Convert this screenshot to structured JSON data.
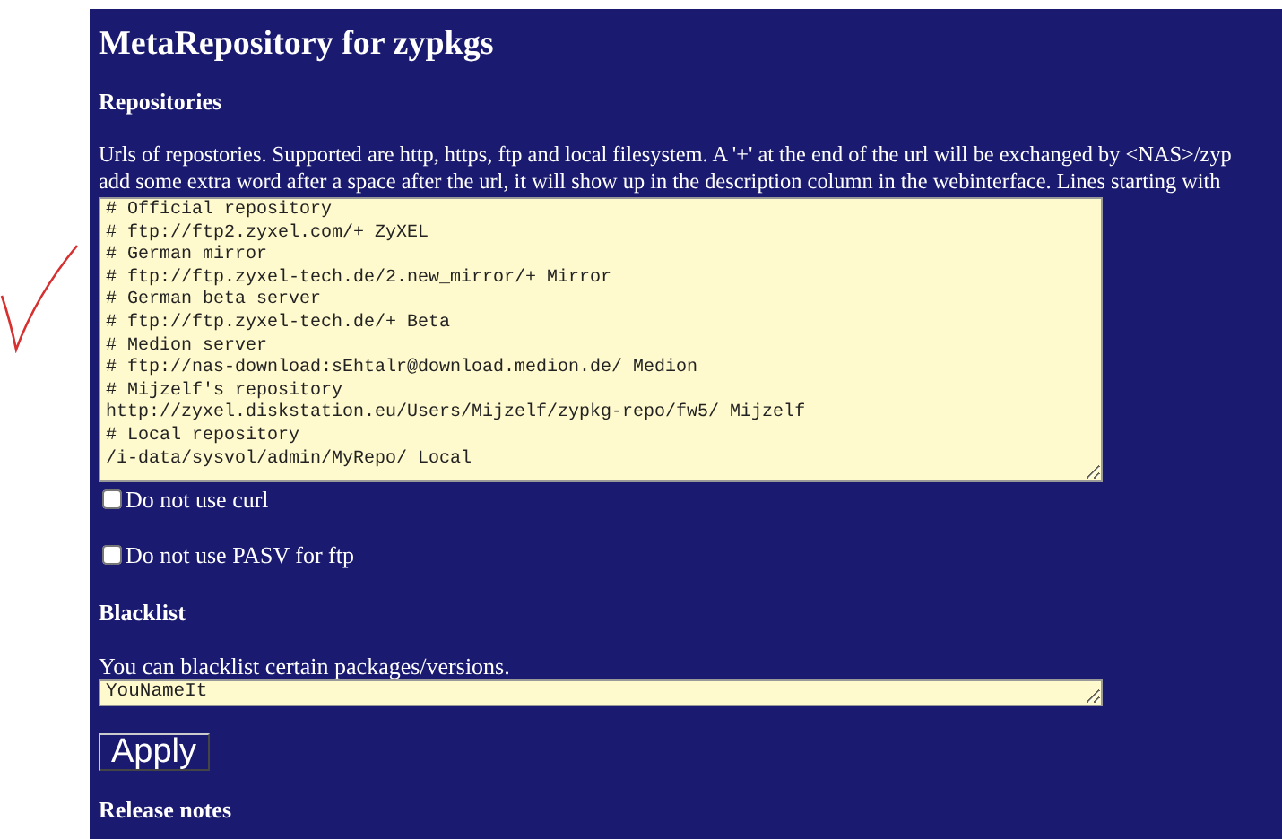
{
  "title": "MetaRepository for zypkgs",
  "repositories": {
    "heading": "Repositories",
    "description": [
      "Urls of repostories. Supported are http, https, ftp and local filesystem. A '+' at the end of the url will be exchanged by <NAS>/zyp",
      "add some extra word after a space after the url, it will show up in the description column in the webinterface. Lines starting with"
    ],
    "lines": [
      "# Official repository",
      "# ftp://ftp2.zyxel.com/+ ZyXEL",
      "# German mirror",
      "# ftp://ftp.zyxel-tech.de/2.new_mirror/+ Mirror",
      "# German beta server",
      "# ftp://ftp.zyxel-tech.de/+ Beta",
      "# Medion server",
      "# ftp://nas-download:sEhtalr@download.medion.de/ Medion",
      "# Mijzelf's repository",
      "http://zyxel.diskstation.eu/Users/Mijzelf/zypkg-repo/fw5/ Mijzelf",
      "# Local repository",
      "/i-data/sysvol/admin/MyRepo/ Local"
    ]
  },
  "options": [
    {
      "label": "Do not use curl",
      "checked": false
    },
    {
      "label": "Do not use PASV for ftp",
      "checked": false
    }
  ],
  "blacklist": {
    "heading": "Blacklist",
    "description": "You can blacklist certain packages/versions.",
    "value": "YouNameIt"
  },
  "apply_button": "Apply",
  "release_notes": {
    "heading": "Release notes"
  }
}
